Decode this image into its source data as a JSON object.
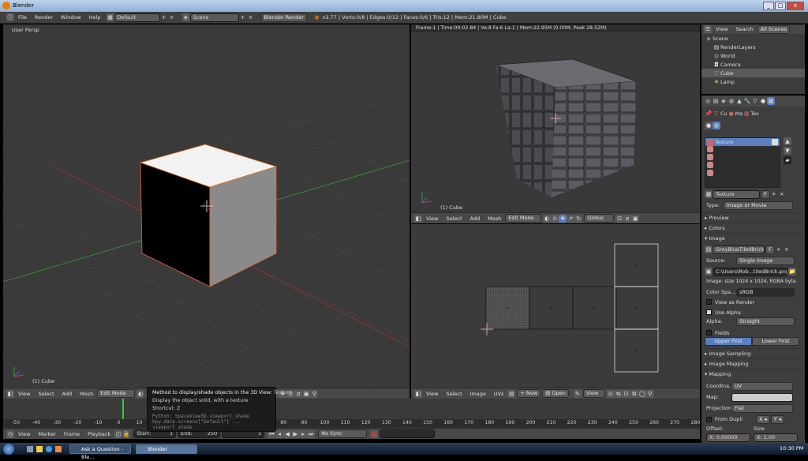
{
  "window": {
    "title": "Blender"
  },
  "infobar": {
    "menus": [
      "File",
      "Render",
      "Window",
      "Help"
    ],
    "screen_layout": "Default",
    "scene": "Scene",
    "engine": "Blender Render",
    "stats": "v2.77 | Verts:0/8 | Edges:0/12 | Faces:0/6 | Tris:12 | Mem:21.80M | Cube"
  },
  "view3d_left": {
    "view_label": "User Persp",
    "object_label": "(1) Cube",
    "header": {
      "menus": [
        "View",
        "Select",
        "Add",
        "Mesh"
      ],
      "mode": "Edit Mode"
    }
  },
  "render_view": {
    "status": "Frame:1 | Time:00:02.84 | Ve:8 Fa:6 La:1 | Mem:22.95M (0.00M, Peak 28.52M)",
    "object_label": "(1) Cube",
    "header": {
      "menus": [
        "View",
        "Select",
        "Add",
        "Mesh"
      ],
      "mode": "Edit Mode",
      "orientation": "Global"
    }
  },
  "uv_editor": {
    "header": {
      "menus": [
        "View",
        "Select",
        "Image",
        "UVs"
      ],
      "new": "New",
      "open": "Open",
      "view": "View"
    }
  },
  "tooltip": {
    "title": "Method to display/shade objects in the 3D View:",
    "title_value": "Texture",
    "line1": "Display the object solid, with a texture",
    "shortcut": "Shortcut: Z",
    "python1": "Python: SpaceView3D.viewport_shade",
    "python2": "bpy.data.screens[\"Default\"] ... viewport_shade"
  },
  "timeline": {
    "ticks": [
      "-50",
      "-40",
      "-30",
      "-20",
      "-10",
      "0",
      "10",
      "20",
      "30",
      "40",
      "50",
      "60",
      "70",
      "80",
      "90",
      "100",
      "110",
      "120",
      "130",
      "140",
      "150",
      "160",
      "170",
      "180",
      "190",
      "200",
      "210",
      "220",
      "230",
      "240",
      "250",
      "260",
      "270",
      "280"
    ],
    "menus": [
      "View",
      "Marker",
      "Frame",
      "Playback"
    ],
    "start_label": "Start:",
    "start": "1",
    "end_label": "End:",
    "end": "250",
    "current": "1",
    "sync": "No Sync"
  },
  "outliner": {
    "tabs": [
      "View",
      "Search",
      "All Scenes"
    ],
    "items": [
      "Scene",
      "RenderLayers",
      "World",
      "Camera",
      "Cube",
      "Lamp"
    ]
  },
  "properties": {
    "breadcrumbs": [
      "Cu",
      "Ma",
      "Tex"
    ],
    "texture_slot": "Texture",
    "texture_name": "Texture",
    "type_label": "Type:",
    "type_value": "Image or Movie",
    "preview": "Preview",
    "colors": "Colors",
    "image": "Image",
    "image_name": "GreyBlueTiledBrick...",
    "image_f": "F",
    "source_label": "Source:",
    "source_value": "Single Image",
    "path": "C:\\Users\\Rob...tiledBrick.png",
    "size_info": "Image: size 1024 x 1024, RGBA byte",
    "colorspace_label": "Color Spa...",
    "colorspace_value": "sRGB",
    "view_as_render": "View as Render",
    "use_alpha": "Use Alpha",
    "alpha_label": "Alpha:",
    "alpha_value": "Straight",
    "fields": "Fields",
    "upper_first": "Upper First",
    "lower_first": "Lower First",
    "image_sampling": "Image Sampling",
    "image_mapping": "Image Mapping",
    "mapping": "Mapping",
    "coord_label": "Coordina...",
    "coord_value": "UV",
    "map_label": "Map:",
    "projection_label": "Projection:",
    "projection_value": "Flat",
    "from_dupli": "From Dupli",
    "offset_label": "Offset:",
    "size_label": "Size:",
    "offset_x": "X: 0.00000",
    "size_x": "X: 1.00"
  },
  "taskbar": {
    "tasks": [
      "Ask a Question - Ble...",
      "Blender"
    ],
    "clock": "10:30 PM"
  },
  "colors": {
    "accent_blue": "#5a7fc0",
    "selected_edge": "#e8883a",
    "grid_red": "#a03030",
    "grid_green": "#3a9a3a"
  }
}
